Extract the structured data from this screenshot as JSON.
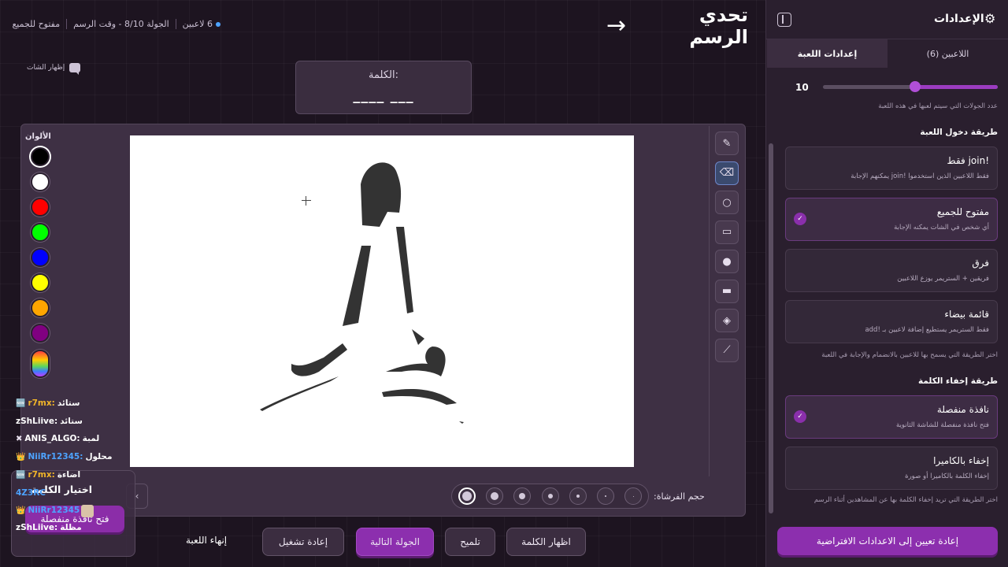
{
  "header": {
    "title": "تحدي الرسم",
    "players_count": "6 لاعبين",
    "round_info": "الجولة 8/10 - وقت الرسم",
    "mode": "مفتوح للجميع",
    "show_chat": "إظهار الشات"
  },
  "word": {
    "label": "الكلمة:",
    "hint": "____ ___"
  },
  "colors": {
    "title": "الألوان",
    "swatches": [
      "#000000",
      "#ffffff",
      "#ff0000",
      "#00ff00",
      "#0000ff",
      "#ffff00",
      "#ffa500",
      "#800080"
    ]
  },
  "brush": {
    "label": "حجم الفرشاة:"
  },
  "tools": [
    "brush-icon",
    "eraser-icon",
    "circle-icon",
    "rectangle-icon",
    "filled-circle-icon",
    "filled-rectangle-icon",
    "fill-bucket-icon",
    "line-icon"
  ],
  "chat": [
    {
      "badge": "🆕",
      "user": "r7mx:",
      "msg": "ستائد",
      "color": "#f0b429"
    },
    {
      "badge": "",
      "user": "zShLiive:",
      "msg": "ستائد",
      "color": "#ffffff"
    },
    {
      "badge": "✖",
      "user": "ANIS_ALGO:",
      "msg": "لمبة",
      "color": "#ffffff"
    },
    {
      "badge": "👑",
      "user": "NiiRr12345:",
      "msg": "محلول",
      "color": "#4da3ff"
    },
    {
      "badge": "🆕",
      "user": "r7mx:",
      "msg": "اضاءة",
      "color": "#f0b429"
    },
    {
      "badge": "",
      "user": "4Z3RC",
      "msg": "",
      "color": "#4da3ff"
    },
    {
      "badge": "👑",
      "user": "NiiRr12345",
      "msg": "",
      "color": "#4da3ff"
    },
    {
      "badge": "",
      "user": "zShLiive:",
      "msg": "مظلة",
      "color": "#ffffff"
    }
  ],
  "word_select": {
    "title": "اختيار الكلمة",
    "popout_button": "فتح نافذة منفصلة"
  },
  "controls": {
    "show_word": "اظهار الكلمة",
    "hint": "تلميح",
    "next_round": "الجولة التالية",
    "restart": "إعادة تشغيل",
    "end_game": "إنهاء اللعبة"
  },
  "sidebar": {
    "title": "الإعدادات",
    "tabs": {
      "players": "اللاعبين (6)",
      "game_settings": "إعدادات اللعبة"
    },
    "rounds": {
      "value": "10",
      "fraction": 0.53,
      "note": "عدد الجولات التي سيتم لعبها في هذه اللعبة"
    },
    "join_section": {
      "title": "طريقة دخول اللعبة",
      "options": [
        {
          "title": "!join فقط",
          "desc": "فقط اللاعبين الذين استخدموا !join يمكنهم الإجابة",
          "selected": false
        },
        {
          "title": "مفتوح للجميع",
          "desc": "أي شخص في الشات يمكنه الإجابة",
          "selected": true
        },
        {
          "title": "فرق",
          "desc": "فريقين + الستريمر يوزع اللاعبين",
          "selected": false
        },
        {
          "title": "قائمة بيضاء",
          "desc": "فقط الستريمر يستطيع إضافة لاعبين بـ !add",
          "selected": false
        }
      ],
      "note": "اختر الطريقة التي يسمح بها للاعبين بالانضمام والإجابة في اللعبة"
    },
    "hide_section": {
      "title": "طريقة إخفاء الكلمة",
      "options": [
        {
          "title": "نافذة منفصلة",
          "desc": "فتح نافذة منفصلة للشاشة الثانوية",
          "selected": true
        },
        {
          "title": "إخفاء بالكاميرا",
          "desc": "إخفاء الكلمة بالكاميرا أو صورة",
          "selected": false
        }
      ],
      "note": "اختر الطريقة التي تريد إخفاء الكلمة بها عن المشاهدين أثناء الرسم"
    },
    "reset_button": "إعادة تعيين إلى الاعدادات الافتراضية"
  },
  "accent_color": "#8c2fae"
}
